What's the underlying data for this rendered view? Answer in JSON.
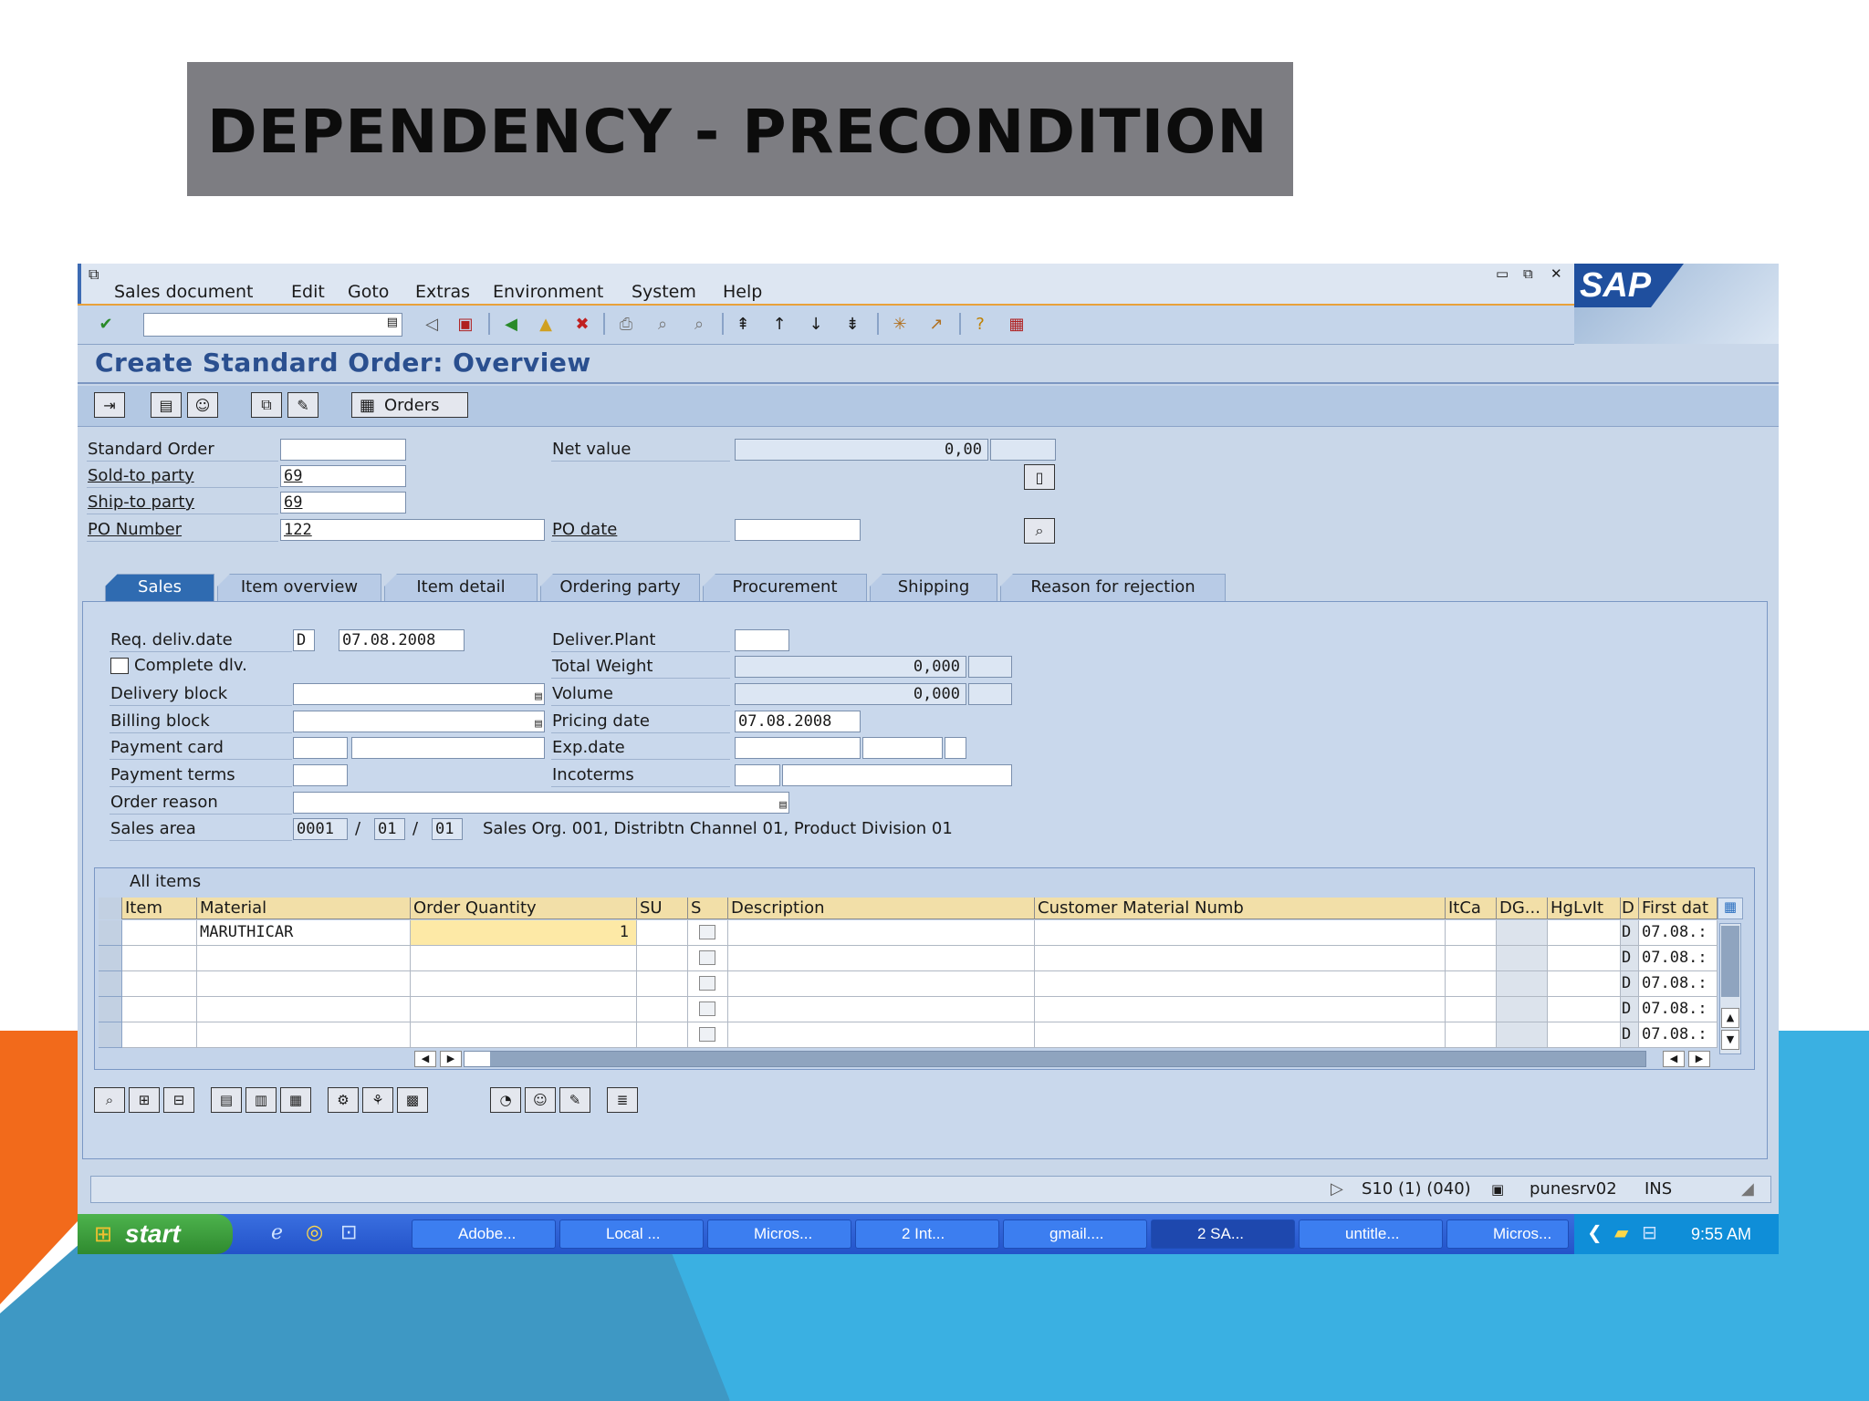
{
  "slide": {
    "title": "DEPENDENCY - PRECONDITION"
  },
  "colors": {
    "title_bg": "#7d7d82",
    "accent_orange": "#f26a1b",
    "accent_blue": "#3ab0e2",
    "sap_blue": "#1f4f9e"
  },
  "sap": {
    "logo": "SAP",
    "menu": [
      "Sales document",
      "Edit",
      "Goto",
      "Extras",
      "Environment",
      "System",
      "Help"
    ],
    "screen_title": "Create Standard Order: Overview",
    "orders_label": "Orders",
    "header": {
      "standard_order_label": "Standard Order",
      "standard_order_value": "",
      "net_value_label": "Net value",
      "net_value": "0,00",
      "sold_to_label": "Sold-to party",
      "sold_to_value": "69",
      "ship_to_label": "Ship-to party",
      "ship_to_value": "69",
      "po_number_label": "PO Number",
      "po_number_value": "122",
      "po_date_label": "PO date",
      "po_date_value": ""
    },
    "tabs": [
      "Sales",
      "Item overview",
      "Item detail",
      "Ordering party",
      "Procurement",
      "Shipping",
      "Reason for rejection"
    ],
    "sales": {
      "req_deliv_label": "Req. deliv.date",
      "req_deliv_format": "D",
      "req_deliv_value": "07.08.2008",
      "complete_dlv_label": "Complete dlv.",
      "delivery_block_label": "Delivery block",
      "billing_block_label": "Billing block",
      "payment_card_label": "Payment card",
      "payment_terms_label": "Payment terms",
      "order_reason_label": "Order reason",
      "sales_area_label": "Sales area",
      "sales_org": "0001",
      "dist_channel": "01",
      "division": "01",
      "slash": "/",
      "sales_area_text": "Sales Org. 001, Distribtn Channel 01, Product Division 01",
      "deliver_plant_label": "Deliver.Plant",
      "total_weight_label": "Total Weight",
      "total_weight": "0,000",
      "volume_label": "Volume",
      "volume": "0,000",
      "pricing_date_label": "Pricing date",
      "pricing_date": "07.08.2008",
      "exp_date_label": "Exp.date",
      "incoterms_label": "Incoterms"
    },
    "grid": {
      "title": "All items",
      "columns": [
        "Item",
        "Material",
        "Order Quantity",
        "SU",
        "S",
        "Description",
        "Customer Material Numb",
        "ItCa",
        "DG...",
        "HgLvIt",
        "D",
        "First dat"
      ],
      "rows": [
        {
          "material": "MARUTHICAR",
          "qty": "1",
          "d": "D",
          "first": "07.08.:"
        },
        {
          "material": "",
          "qty": "",
          "d": "D",
          "first": "07.08.:"
        },
        {
          "material": "",
          "qty": "",
          "d": "D",
          "first": "07.08.:"
        },
        {
          "material": "",
          "qty": "",
          "d": "D",
          "first": "07.08.:"
        },
        {
          "material": "",
          "qty": "",
          "d": "D",
          "first": "07.08.:"
        }
      ]
    },
    "status": {
      "session": "S10 (1) (040)",
      "server": "punesrv02",
      "mode": "INS"
    }
  },
  "taskbar": {
    "start": "start",
    "tasks": [
      "Adobe...",
      "Local ...",
      "Micros...",
      "2 Int...",
      "gmail....",
      "2 SA...",
      "untitle...",
      "Micros..."
    ],
    "time": "9:55 AM"
  }
}
